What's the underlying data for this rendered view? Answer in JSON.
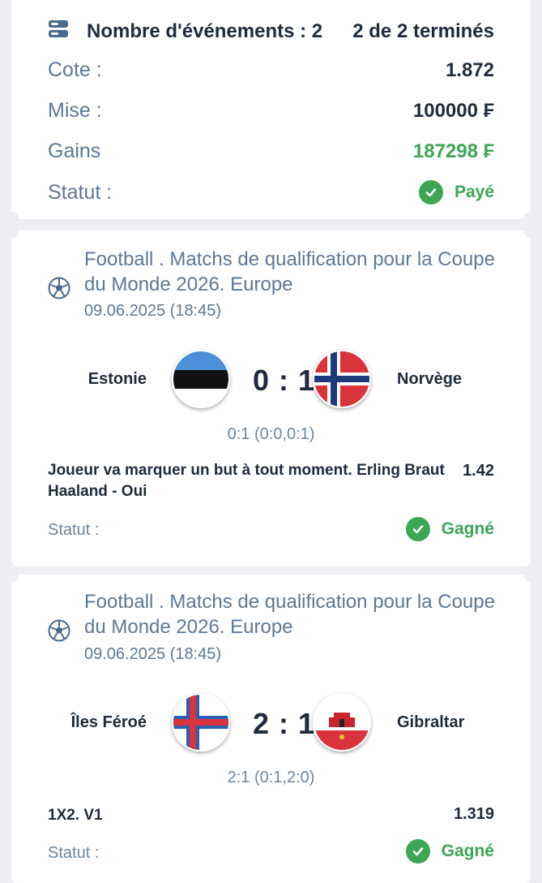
{
  "summary": {
    "events_label": "Nombre d'événements : 2",
    "completed": "2 de 2 terminés",
    "rows": [
      {
        "label": "Cote :",
        "value": "1.872"
      },
      {
        "label": "Mise :",
        "value": "100000 ₣"
      },
      {
        "label": "Gains",
        "value": "187298 ₣"
      },
      {
        "label": "Statut :",
        "value": "Payé"
      }
    ]
  },
  "events": [
    {
      "title": "Football . Matchs de qualification pour la Coupe du Monde 2026. Europe",
      "date": "09.06.2025 (18:45)",
      "home": "Estonie",
      "away": "Norvège",
      "score": "0 : 1",
      "detail": "0:1 (0:0,0:1)",
      "bet": "Joueur va marquer un but à tout moment. Erling Braut Haaland - Oui",
      "odd": "1.42",
      "status_label": "Statut :",
      "status": "Gagné"
    },
    {
      "title": "Football . Matchs de qualification pour la Coupe du Monde 2026. Europe",
      "date": "09.06.2025 (18:45)",
      "home": "Îles Féroé",
      "away": "Gibraltar",
      "score": "2 : 1",
      "detail": "2:1 (0:1,2:0)",
      "bet": "1X2. V1",
      "odd": "1.319",
      "status_label": "Statut :",
      "status": "Gagné"
    }
  ],
  "colors": {
    "accent_green": "#3ca655",
    "text_dark": "#1e2b3d",
    "text_muted": "#5d7896"
  }
}
